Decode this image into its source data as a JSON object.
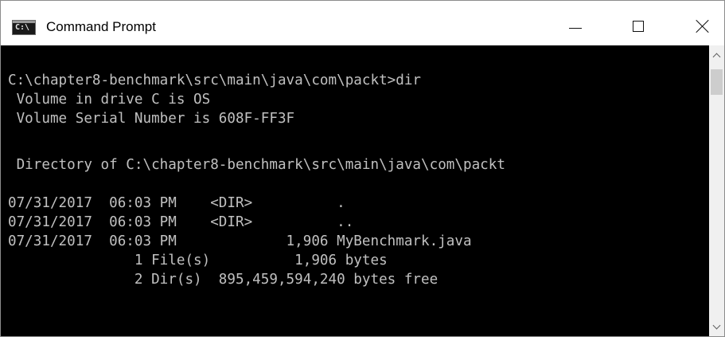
{
  "window": {
    "title": "Command Prompt",
    "icon_label": "C:\\",
    "icon": "console-app-icon"
  },
  "controls": {
    "minimize": "minimize-icon",
    "maximize": "maximize-icon",
    "close": "close-icon"
  },
  "console": {
    "lines": [
      "C:\\chapter8-benchmark\\src\\main\\java\\com\\packt>dir",
      " Volume in drive C is OS",
      " Volume Serial Number is 608F-FF3F",
      "",
      " Directory of C:\\chapter8-benchmark\\src\\main\\java\\com\\packt",
      "",
      "07/31/2017  06:03 PM    <DIR>          .",
      "07/31/2017  06:03 PM    <DIR>          ..",
      "07/31/2017  06:03 PM             1,906 MyBenchmark.java",
      "               1 File(s)          1,906 bytes",
      "               2 Dir(s)  895,459,594,240 bytes free"
    ]
  },
  "scrollbar": {
    "up_icon": "scroll-up-arrow-icon",
    "down_icon": "scroll-down-arrow-icon"
  },
  "colors": {
    "console_background": "#000000",
    "console_text": "#c0c0c0",
    "titlebar_background": "#ffffff"
  }
}
